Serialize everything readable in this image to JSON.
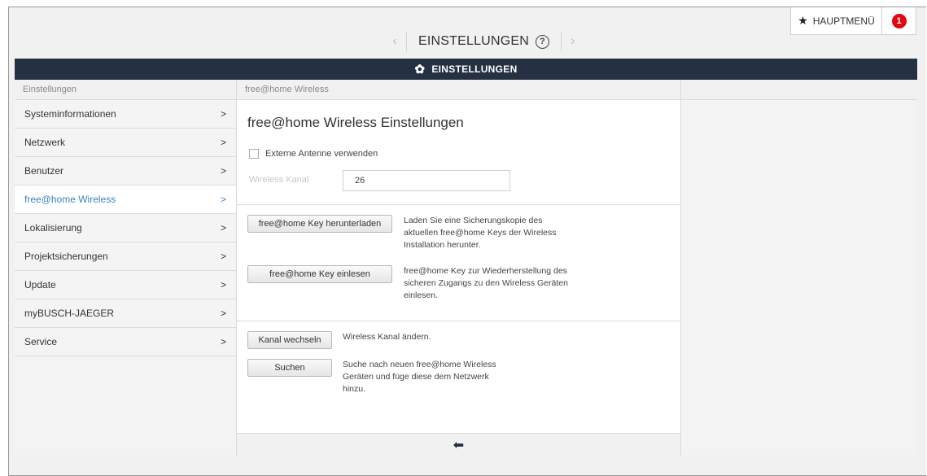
{
  "topbar": {
    "title": "EINSTELLUNGEN",
    "help_icon": "?",
    "prev_arrow": "‹",
    "next_arrow": "›",
    "main_menu_label": "HAUPTMENÜ",
    "notification_count": "1"
  },
  "header": {
    "title": "EINSTELLUNGEN"
  },
  "sidebar": {
    "heading": "Einstellungen",
    "items": [
      {
        "label": "Systeminformationen"
      },
      {
        "label": "Netzwerk"
      },
      {
        "label": "Benutzer"
      },
      {
        "label": "free@home Wireless",
        "active": true
      },
      {
        "label": "Lokalisierung"
      },
      {
        "label": "Projektsicherungen"
      },
      {
        "label": "Update"
      },
      {
        "label": "myBUSCH-JAEGER"
      },
      {
        "label": "Service"
      }
    ]
  },
  "main": {
    "heading": "free@home Wireless",
    "title": "free@home Wireless Einstellungen",
    "external_antenna_label": "Externe Antenne verwenden",
    "channel_label": "Wireless Kanal",
    "channel_value": "26",
    "download_key_button": "free@home Key herunterladen",
    "download_key_desc": "Laden Sie eine Sicherungskopie des aktuellen free@home Keys der Wireless Installation herunter.",
    "import_key_button": "free@home Key einlesen",
    "import_key_desc": "free@home Key zur Wiederherstellung des sicheren Zugangs zu den Wireless Geräten einlesen.",
    "change_channel_button": "Kanal wechseln",
    "change_channel_desc": "Wireless Kanal ändern.",
    "search_button": "Suchen",
    "search_desc": "Suche nach neuen free@home Wireless Geräten und füge diese dem Netzwerk hinzu."
  },
  "colors": {
    "header_bg": "#253042",
    "active_link": "#3d82c4",
    "badge": "#e30613"
  }
}
